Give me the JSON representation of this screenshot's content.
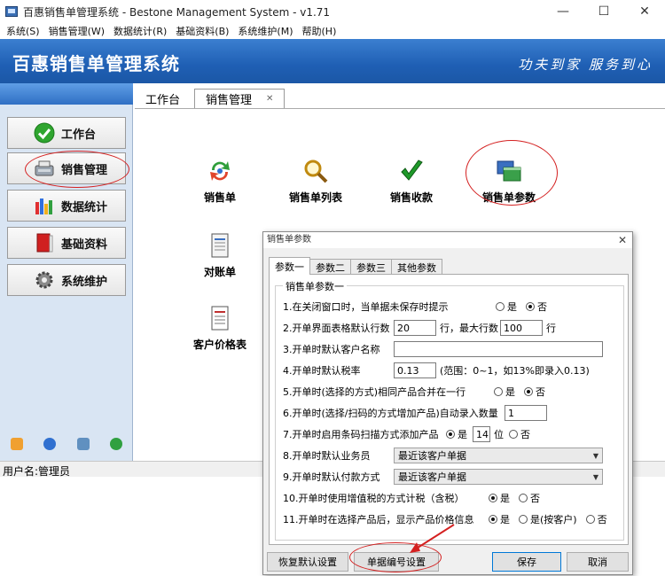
{
  "window": {
    "title": "百惠销售单管理系统 - Bestone Management System - v1.71",
    "minimize": "—",
    "maximize": "☐",
    "close": "✕"
  },
  "menu": [
    "系统(S)",
    "销售管理(W)",
    "数据统计(R)",
    "基础资料(B)",
    "系统维护(M)",
    "帮助(H)"
  ],
  "banner": {
    "title": "百惠销售单管理系统",
    "slogan": "功夫到家 服务到心"
  },
  "sidebar": {
    "items": [
      {
        "label": "工作台",
        "icon": "checkmark-icon"
      },
      {
        "label": "销售管理",
        "icon": "sales-icon"
      },
      {
        "label": "数据统计",
        "icon": "bar-chart-icon"
      },
      {
        "label": "基础资料",
        "icon": "book-icon"
      },
      {
        "label": "系统维护",
        "icon": "gear-icon"
      }
    ]
  },
  "status": {
    "user": "用户名:管理员"
  },
  "workspace": {
    "tabs": [
      {
        "label": "工作台"
      },
      {
        "label": "销售管理"
      }
    ],
    "functions": [
      {
        "label": "销售单",
        "icon": "refresh-arrows-icon"
      },
      {
        "label": "销售单列表",
        "icon": "magnifier-icon"
      },
      {
        "label": "销售收款",
        "icon": "green-check-icon"
      },
      {
        "label": "销售单参数",
        "icon": "windows-icon"
      },
      {
        "label": "对账单",
        "icon": "document-icon"
      },
      {
        "label": "客户价格表",
        "icon": "list-icon"
      }
    ]
  },
  "dialog": {
    "title": "销售单参数",
    "close": "✕",
    "tabs": [
      "参数一",
      "参数二",
      "参数三",
      "其他参数"
    ],
    "group_title": "销售单参数一",
    "yes": "是",
    "no": "否",
    "rows": {
      "r1": "1.在关闭窗口时，当单据未保存时提示",
      "r2a": "2.开单界面表格默认行数",
      "r2_rows": "20",
      "r2b": "行，最大行数",
      "r2_max": "100",
      "r2c": "行",
      "r3": "3.开单时默认客户名称",
      "r3_value": "",
      "r4": "4.开单时默认税率",
      "r4_value": "0.13",
      "r4_hint": "(范围：0~1，如13%即录入0.13)",
      "r5": "5.开单时(选择的方式)相同产品合并在一行",
      "r6": "6.开单时(选择/扫码的方式增加产品)自动录入数量",
      "r6_value": "1",
      "r7": "7.开单时启用条码扫描方式添加产品",
      "r7_digits": "14",
      "r7_unit": "位",
      "r8": "8.开单时默认业务员",
      "r8_value": "最近该客户单据",
      "r9": "9.开单时默认付款方式",
      "r9_value": "最近该客户单据",
      "r10": "10.开单时使用增值税的方式计税（含税）",
      "r11": "11.开单时在选择产品后，显示产品价格信息",
      "r11_yes_by_customer": "是(按客户)"
    },
    "buttons": {
      "restore": "恢复默认设置",
      "numbering": "单据编号设置",
      "save": "保存",
      "cancel": "取消"
    }
  },
  "colors": {
    "banner": "#1f5fb4",
    "annotation": "#d42020"
  }
}
